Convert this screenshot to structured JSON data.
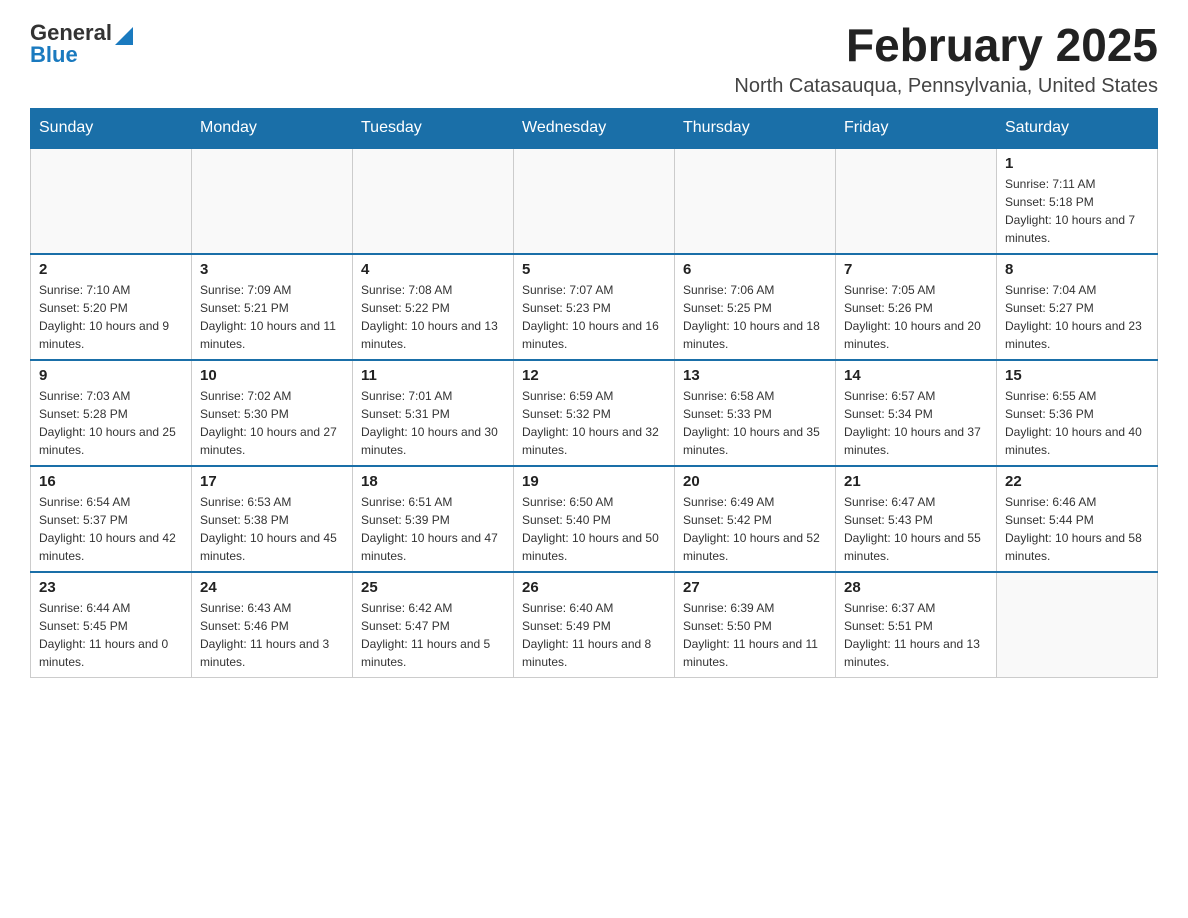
{
  "logo": {
    "text_general": "General",
    "text_blue": "Blue"
  },
  "header": {
    "month_year": "February 2025",
    "location": "North Catasauqua, Pennsylvania, United States"
  },
  "weekdays": [
    "Sunday",
    "Monday",
    "Tuesday",
    "Wednesday",
    "Thursday",
    "Friday",
    "Saturday"
  ],
  "weeks": [
    [
      {
        "day": "",
        "info": ""
      },
      {
        "day": "",
        "info": ""
      },
      {
        "day": "",
        "info": ""
      },
      {
        "day": "",
        "info": ""
      },
      {
        "day": "",
        "info": ""
      },
      {
        "day": "",
        "info": ""
      },
      {
        "day": "1",
        "info": "Sunrise: 7:11 AM\nSunset: 5:18 PM\nDaylight: 10 hours and 7 minutes."
      }
    ],
    [
      {
        "day": "2",
        "info": "Sunrise: 7:10 AM\nSunset: 5:20 PM\nDaylight: 10 hours and 9 minutes."
      },
      {
        "day": "3",
        "info": "Sunrise: 7:09 AM\nSunset: 5:21 PM\nDaylight: 10 hours and 11 minutes."
      },
      {
        "day": "4",
        "info": "Sunrise: 7:08 AM\nSunset: 5:22 PM\nDaylight: 10 hours and 13 minutes."
      },
      {
        "day": "5",
        "info": "Sunrise: 7:07 AM\nSunset: 5:23 PM\nDaylight: 10 hours and 16 minutes."
      },
      {
        "day": "6",
        "info": "Sunrise: 7:06 AM\nSunset: 5:25 PM\nDaylight: 10 hours and 18 minutes."
      },
      {
        "day": "7",
        "info": "Sunrise: 7:05 AM\nSunset: 5:26 PM\nDaylight: 10 hours and 20 minutes."
      },
      {
        "day": "8",
        "info": "Sunrise: 7:04 AM\nSunset: 5:27 PM\nDaylight: 10 hours and 23 minutes."
      }
    ],
    [
      {
        "day": "9",
        "info": "Sunrise: 7:03 AM\nSunset: 5:28 PM\nDaylight: 10 hours and 25 minutes."
      },
      {
        "day": "10",
        "info": "Sunrise: 7:02 AM\nSunset: 5:30 PM\nDaylight: 10 hours and 27 minutes."
      },
      {
        "day": "11",
        "info": "Sunrise: 7:01 AM\nSunset: 5:31 PM\nDaylight: 10 hours and 30 minutes."
      },
      {
        "day": "12",
        "info": "Sunrise: 6:59 AM\nSunset: 5:32 PM\nDaylight: 10 hours and 32 minutes."
      },
      {
        "day": "13",
        "info": "Sunrise: 6:58 AM\nSunset: 5:33 PM\nDaylight: 10 hours and 35 minutes."
      },
      {
        "day": "14",
        "info": "Sunrise: 6:57 AM\nSunset: 5:34 PM\nDaylight: 10 hours and 37 minutes."
      },
      {
        "day": "15",
        "info": "Sunrise: 6:55 AM\nSunset: 5:36 PM\nDaylight: 10 hours and 40 minutes."
      }
    ],
    [
      {
        "day": "16",
        "info": "Sunrise: 6:54 AM\nSunset: 5:37 PM\nDaylight: 10 hours and 42 minutes."
      },
      {
        "day": "17",
        "info": "Sunrise: 6:53 AM\nSunset: 5:38 PM\nDaylight: 10 hours and 45 minutes."
      },
      {
        "day": "18",
        "info": "Sunrise: 6:51 AM\nSunset: 5:39 PM\nDaylight: 10 hours and 47 minutes."
      },
      {
        "day": "19",
        "info": "Sunrise: 6:50 AM\nSunset: 5:40 PM\nDaylight: 10 hours and 50 minutes."
      },
      {
        "day": "20",
        "info": "Sunrise: 6:49 AM\nSunset: 5:42 PM\nDaylight: 10 hours and 52 minutes."
      },
      {
        "day": "21",
        "info": "Sunrise: 6:47 AM\nSunset: 5:43 PM\nDaylight: 10 hours and 55 minutes."
      },
      {
        "day": "22",
        "info": "Sunrise: 6:46 AM\nSunset: 5:44 PM\nDaylight: 10 hours and 58 minutes."
      }
    ],
    [
      {
        "day": "23",
        "info": "Sunrise: 6:44 AM\nSunset: 5:45 PM\nDaylight: 11 hours and 0 minutes."
      },
      {
        "day": "24",
        "info": "Sunrise: 6:43 AM\nSunset: 5:46 PM\nDaylight: 11 hours and 3 minutes."
      },
      {
        "day": "25",
        "info": "Sunrise: 6:42 AM\nSunset: 5:47 PM\nDaylight: 11 hours and 5 minutes."
      },
      {
        "day": "26",
        "info": "Sunrise: 6:40 AM\nSunset: 5:49 PM\nDaylight: 11 hours and 8 minutes."
      },
      {
        "day": "27",
        "info": "Sunrise: 6:39 AM\nSunset: 5:50 PM\nDaylight: 11 hours and 11 minutes."
      },
      {
        "day": "28",
        "info": "Sunrise: 6:37 AM\nSunset: 5:51 PM\nDaylight: 11 hours and 13 minutes."
      },
      {
        "day": "",
        "info": ""
      }
    ]
  ]
}
